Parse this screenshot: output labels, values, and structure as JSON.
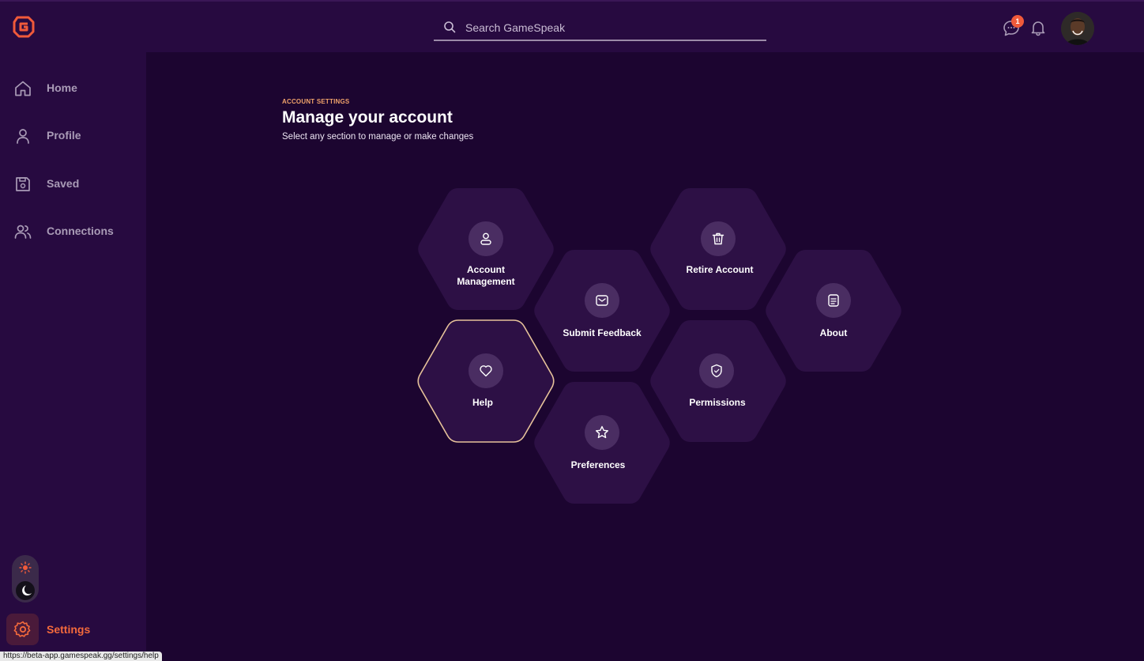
{
  "header": {
    "search_placeholder": "Search GameSpeak",
    "chat_badge_count": "1"
  },
  "sidebar": {
    "items": [
      {
        "label": "Home",
        "icon": "home-icon"
      },
      {
        "label": "Profile",
        "icon": "profile-icon"
      },
      {
        "label": "Saved",
        "icon": "save-icon"
      },
      {
        "label": "Connections",
        "icon": "connections-icon"
      }
    ],
    "settings_label": "Settings"
  },
  "main": {
    "eyebrow": "ACCOUNT SETTINGS",
    "title": "Manage your account",
    "subtitle": "Select any section to manage or make changes",
    "tiles": [
      {
        "label": "Account Management",
        "icon": "user-icon"
      },
      {
        "label": "Submit Feedback",
        "icon": "mail-icon"
      },
      {
        "label": "Retire Account",
        "icon": "trash-icon"
      },
      {
        "label": "About",
        "icon": "document-icon"
      },
      {
        "label": "Help",
        "icon": "heart-icon"
      },
      {
        "label": "Permissions",
        "icon": "shield-icon"
      },
      {
        "label": "Preferences",
        "icon": "star-icon"
      }
    ]
  },
  "status_bar": {
    "url": "https://beta-app.gamespeak.gg/settings/help"
  },
  "colors": {
    "background": "#1c0530",
    "panel": "#270a40",
    "tile": "#2d1045",
    "accent": "#f46a3c",
    "highlight_border": "#e6c29a"
  }
}
